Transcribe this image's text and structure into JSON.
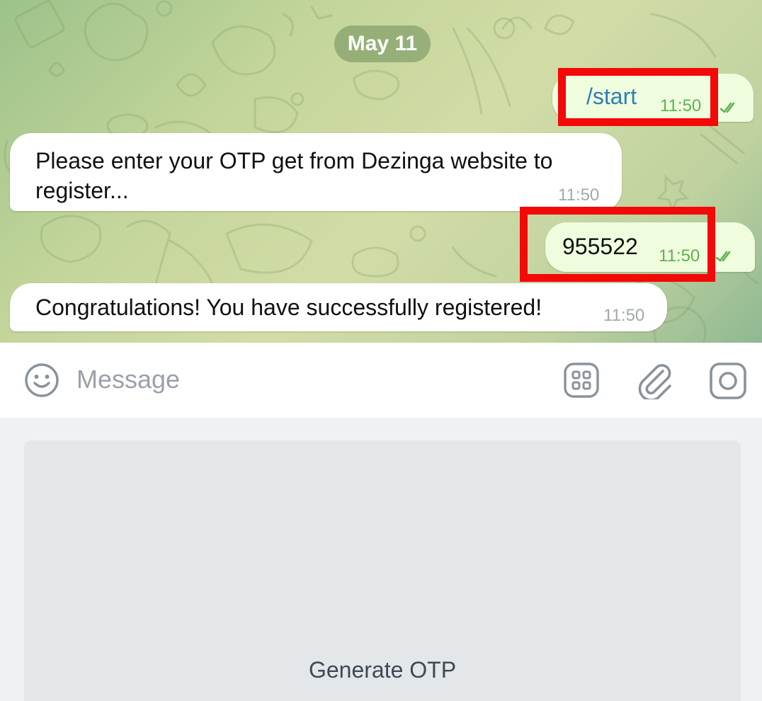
{
  "chat": {
    "date_label": "May 11",
    "messages": [
      {
        "direction": "outgoing",
        "text": "/start",
        "time": "11:50",
        "read": true,
        "highlighted": true
      },
      {
        "direction": "incoming",
        "text": "Please enter your OTP get from Dezinga website to register...",
        "time": "11:50"
      },
      {
        "direction": "outgoing",
        "text": "955522",
        "time": "11:50",
        "read": true,
        "highlighted": true
      },
      {
        "direction": "incoming",
        "text": "Congratulations! You have successfully registered!",
        "time": "11:50"
      }
    ]
  },
  "input_bar": {
    "placeholder": "Message",
    "value": "",
    "icons": [
      "emoji-icon",
      "bot-menu-icon",
      "paperclip-icon",
      "camera-icon"
    ]
  },
  "keyboard": {
    "buttons": [
      {
        "label": "Generate OTP"
      }
    ]
  },
  "colors": {
    "outgoing_bubble": "#effdde",
    "incoming_bubble": "#ffffff",
    "command_link": "#2d7eb9",
    "read_checks": "#5fb14f",
    "highlight": "#f40909",
    "keyboard_button": "#e4e7ea"
  }
}
